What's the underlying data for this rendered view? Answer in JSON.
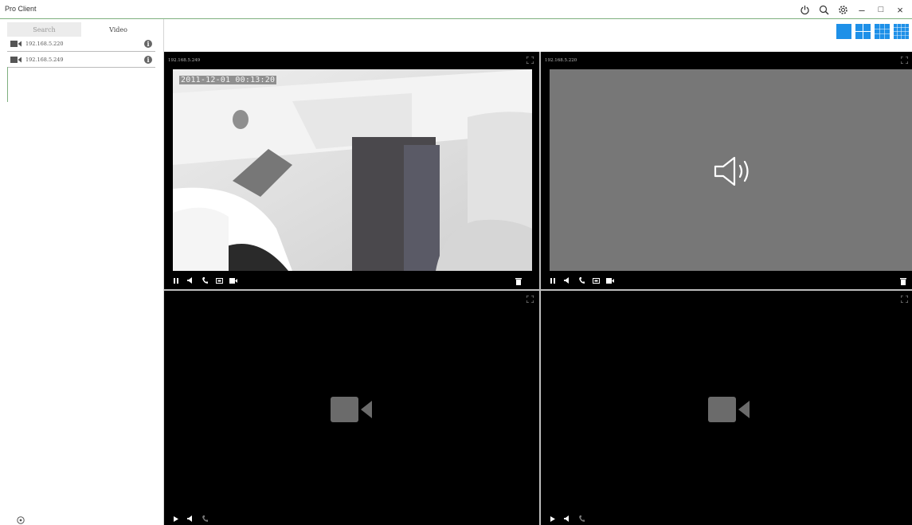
{
  "window": {
    "title": "Pro Client",
    "minimize_glyph": "–",
    "maximize_glyph": "□",
    "close_glyph": "×"
  },
  "sidebar": {
    "tabs": [
      "Search",
      "Video"
    ],
    "active_tab": "Video",
    "devices": [
      {
        "ip": "192.168.5.220",
        "icon": "camera-icon"
      },
      {
        "ip": "192.168.5.249",
        "icon": "camera-icon"
      }
    ]
  },
  "layout_options": [
    "1x1",
    "2x2",
    "3x3",
    "4x4"
  ],
  "panes": [
    {
      "ip": "192.168.5.249",
      "timestamp": "2011-12-01 00:13:20",
      "state": "live-video"
    },
    {
      "ip": "192.168.5.220",
      "state": "audio-only"
    },
    {
      "ip": "",
      "state": "empty"
    },
    {
      "ip": "",
      "state": "empty"
    }
  ],
  "colors": {
    "accent": "#1e90e8",
    "title_divider": "#7fb07f",
    "audio_bg": "#777777",
    "pane_bg": "#000000"
  }
}
